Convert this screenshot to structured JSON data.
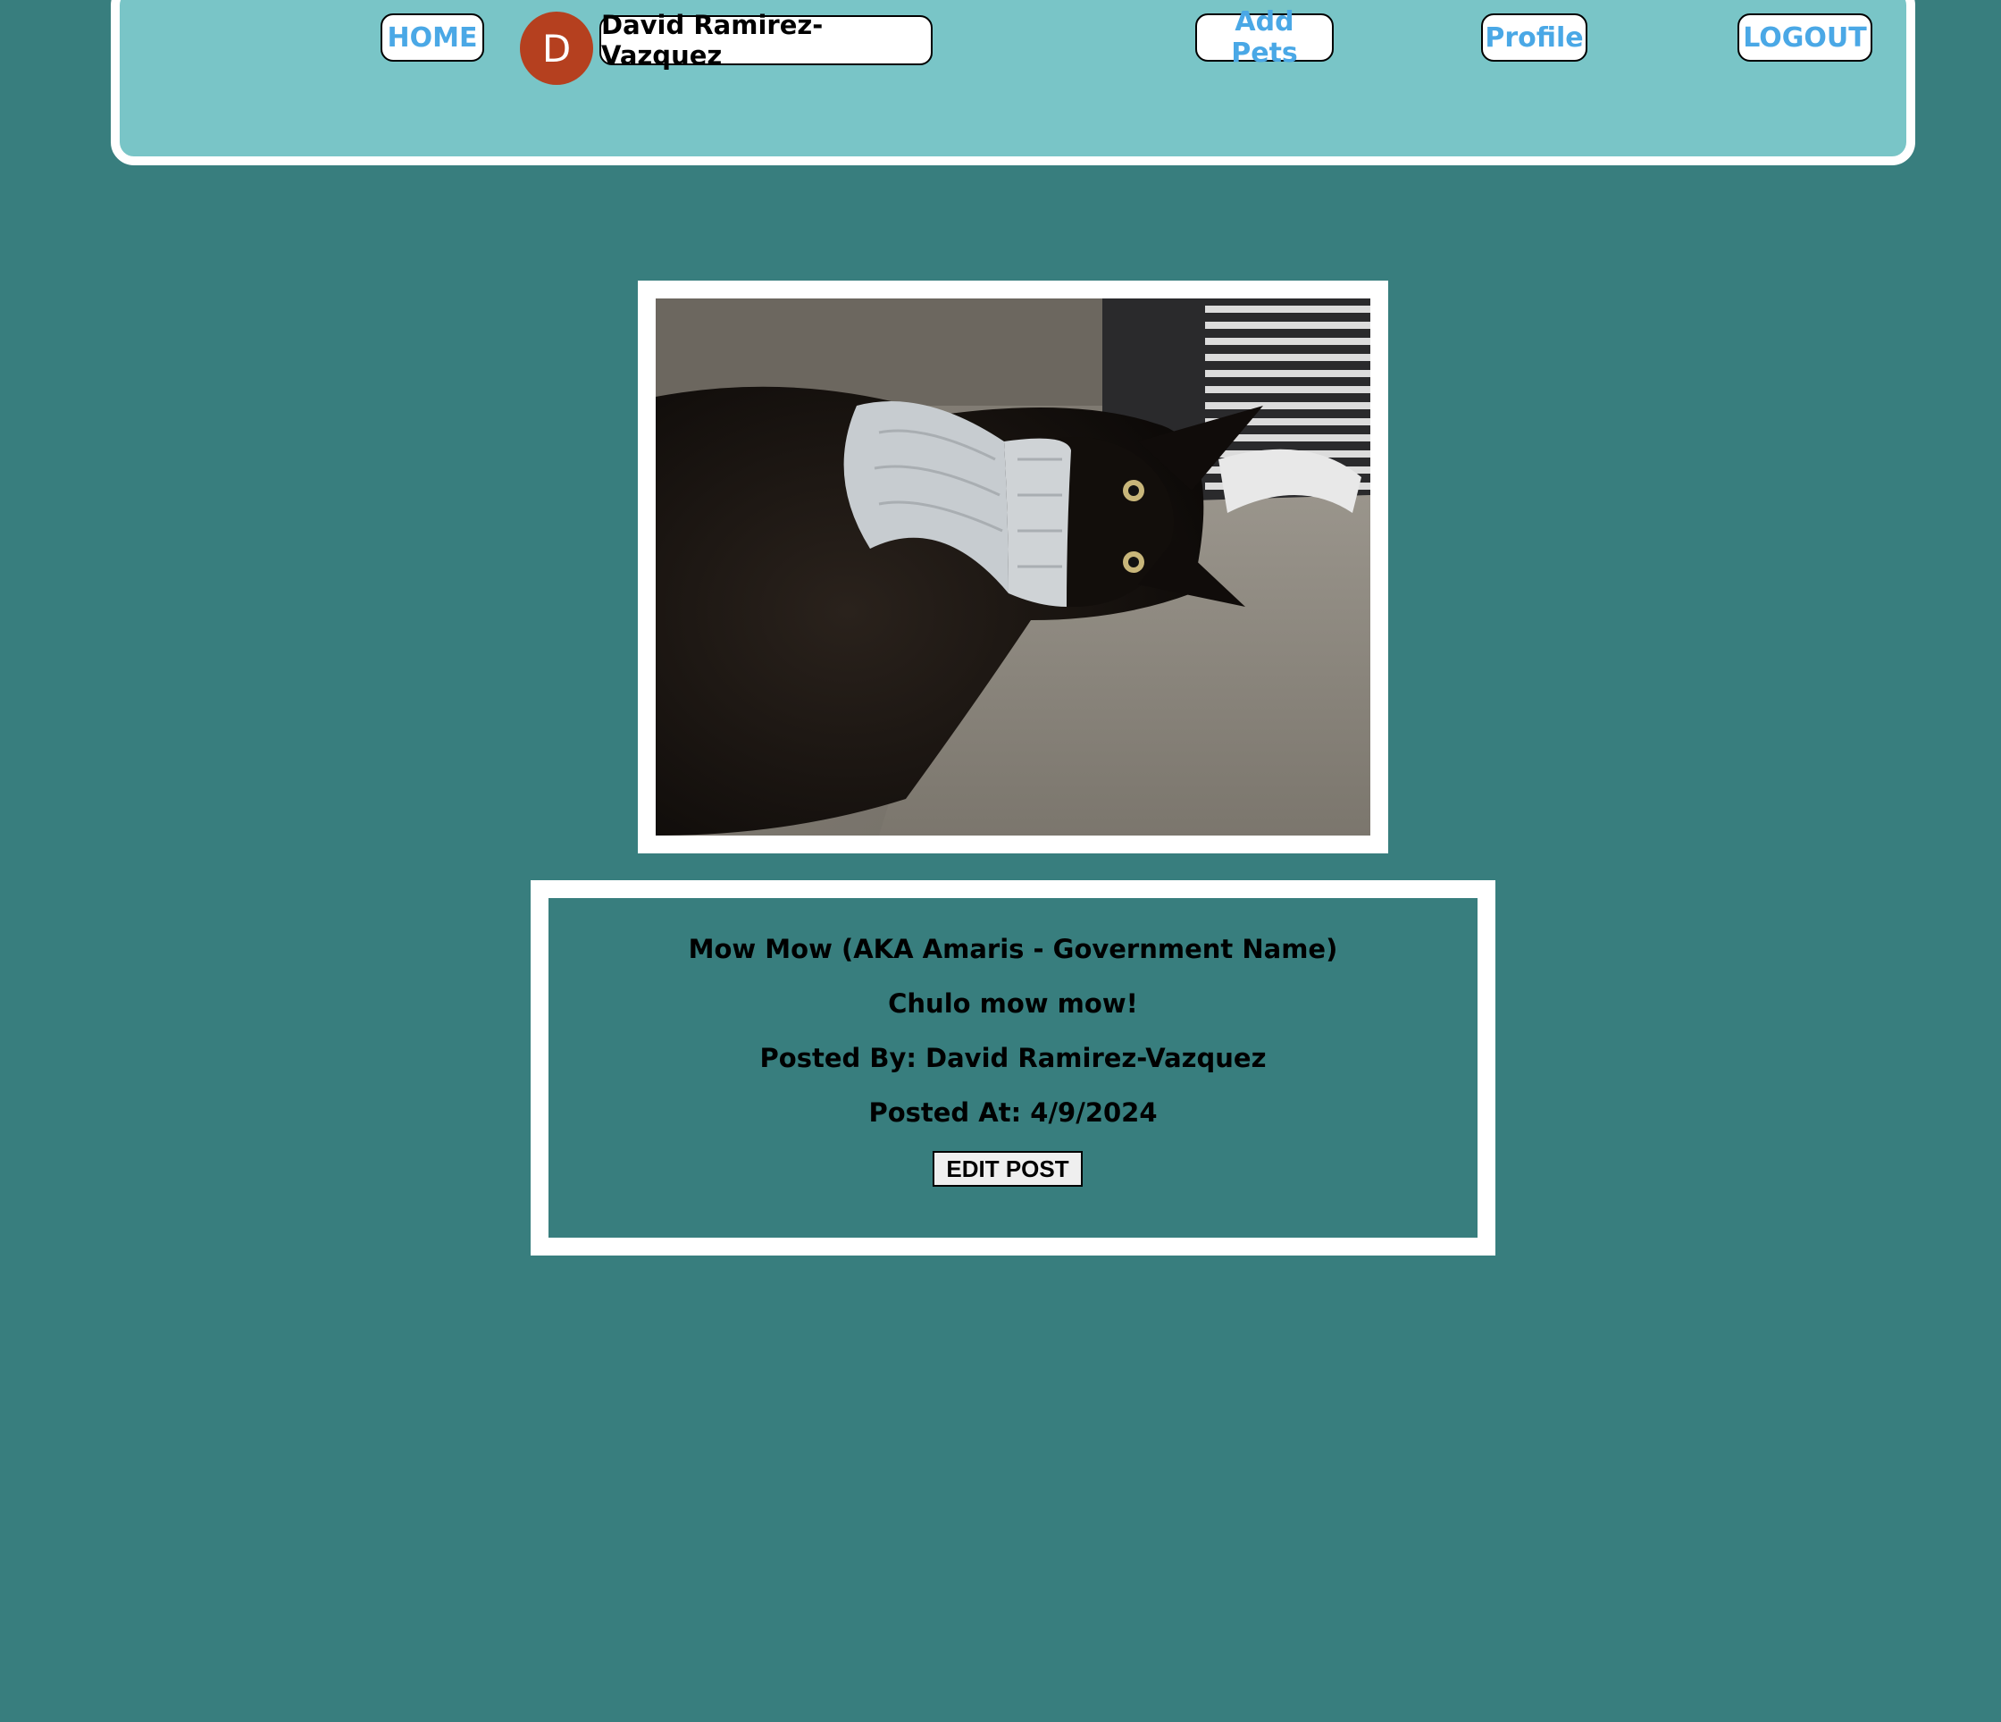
{
  "nav": {
    "home_label": "HOME",
    "user_initial": "D",
    "user_name": "David Ramirez-Vazquez",
    "add_pets_label": "Add Pets",
    "profile_label": "Profile",
    "logout_label": "LOGOUT"
  },
  "post": {
    "pet_name": "Mow Mow (AKA Amaris - Government Name)",
    "description": "Chulo mow mow!",
    "posted_by": "Posted By: David Ramirez-Vazquez",
    "posted_at": "Posted At: 4/9/2024",
    "edit_label": "EDIT POST"
  },
  "colors": {
    "page_background": "#387e7e",
    "navbar_background": "#79c5c7",
    "nav_link_text": "#4aa8e6",
    "avatar_background": "#b5401f",
    "frame_border": "#ffffff"
  }
}
